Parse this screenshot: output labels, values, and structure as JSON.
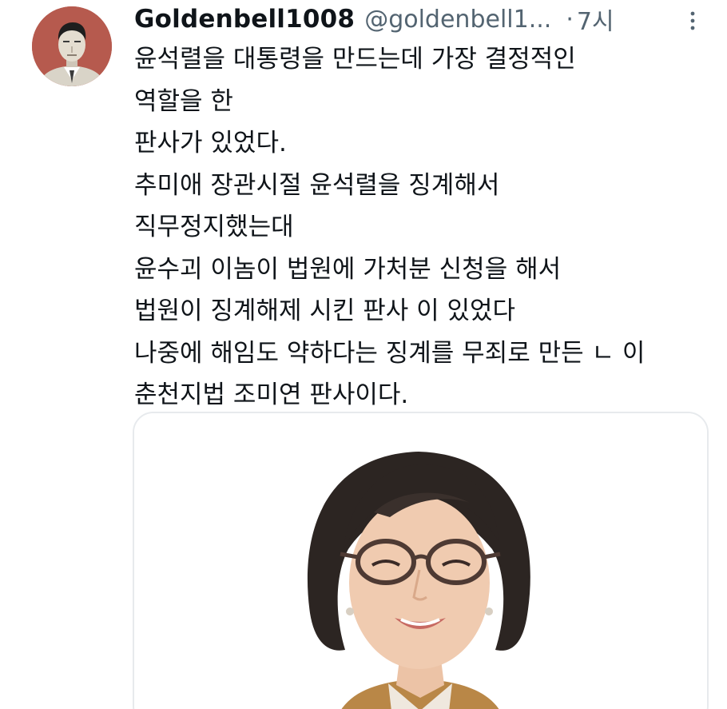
{
  "tweet": {
    "display_name": "Goldenbell1008",
    "handle": "@goldenbell1...",
    "separator": "·",
    "time": "7시",
    "text_lines": [
      "윤석렬을 대통령을 만드는데 가장 결정적인",
      "역할을 한",
      "판사가 있었다.",
      "추미애 장관시절 윤석렬을 징계해서",
      "직무정지했는대",
      "윤수괴 이놈이 법원에 가처분 신청을 해서",
      "법원이 징계해제 시킨 판사 이 있었다",
      "나중에 해임도 약하다는 징계를 무죄로 만든 ㄴ 이",
      "춘천지법 조미연 판사이다."
    ]
  },
  "colors": {
    "text_primary": "#0f1419",
    "text_secondary": "#536471",
    "card_border": "#e7eaed",
    "avatar_bg": "#b65a4e"
  },
  "icons": {
    "more": "more-vertical-icon"
  }
}
